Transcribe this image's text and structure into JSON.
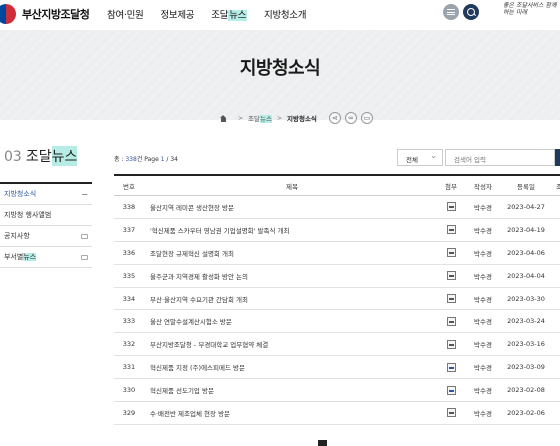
{
  "header": {
    "logo_text": "부산지방조달청",
    "gnb": [
      {
        "label": "참여·민원"
      },
      {
        "label": "정보제공"
      },
      {
        "label_pre": "조달",
        "label_hl": "뉴스"
      },
      {
        "label": "지방청소개"
      }
    ],
    "slogan": "좋은 조달서비스 함께하는 미래"
  },
  "visual": {
    "title": "지방청소식",
    "breadcrumb": {
      "item1_pre": "조달",
      "item1_hl": "뉴스",
      "current": "지방청소식"
    }
  },
  "sidebar": {
    "num": "03",
    "title_pre": "조달",
    "title_hl": "뉴스",
    "items": [
      {
        "label": "지방청소식",
        "active": true,
        "icon": "minus-icon"
      },
      {
        "label": "지방청 행사앨범"
      },
      {
        "label": "공지사항",
        "icon": "external-link-icon"
      },
      {
        "label_pre": "부서별",
        "label_hl": "뉴스",
        "icon": "external-link-icon"
      }
    ]
  },
  "board": {
    "count_pre": "총 : ",
    "count_total": "338",
    "count_mid": "건 Page ",
    "page_current": "1",
    "page_total": " / 34",
    "search_select": "전체",
    "search_placeholder": "검색어 입력",
    "headers": {
      "no": "번호",
      "title": "제목",
      "file": "첨부",
      "writer": "작성자",
      "date": "등록일",
      "view": "조"
    },
    "rows": [
      {
        "no": "338",
        "title": "울산지역 레미콘 생산현장 방문",
        "writer": "박수경",
        "date": "2023-04-27",
        "file": "gray"
      },
      {
        "no": "337",
        "title": "'혁신제품 스카우터 영남권 기업설명회' 발족식 개최",
        "writer": "박수경",
        "date": "2023-04-19",
        "file": "gray"
      },
      {
        "no": "336",
        "title": "조달현장 규제혁신 설명회 개최",
        "writer": "박수경",
        "date": "2023-04-06",
        "file": "gray"
      },
      {
        "no": "335",
        "title": "울주군과 지역경제 활성화 방안 논의",
        "writer": "박수경",
        "date": "2023-04-04",
        "file": "gray"
      },
      {
        "no": "334",
        "title": "부산·울산지역 수요기관 간담회 개최",
        "writer": "박수경",
        "date": "2023-03-30",
        "file": "gray"
      },
      {
        "no": "333",
        "title": "울산 연말수설계산시험소 방문",
        "writer": "박수경",
        "date": "2023-03-24",
        "file": "gray"
      },
      {
        "no": "332",
        "title": "부산지방조달청 - 부경대학교 업무협약 체결",
        "writer": "박수경",
        "date": "2023-03-16",
        "file": "gray"
      },
      {
        "no": "331",
        "title": "혁신제품 지정 (주)에스피메드 방문",
        "writer": "박수경",
        "date": "2023-03-09",
        "file": "blue"
      },
      {
        "no": "330",
        "title": "혁신제품 선도기업 방문",
        "writer": "박수경",
        "date": "2023-02-08",
        "file": "blue"
      },
      {
        "no": "329",
        "title": "수·배전반 제조업체 현장 방문",
        "writer": "박수경",
        "date": "2023-02-06",
        "file": "gray"
      }
    ]
  }
}
